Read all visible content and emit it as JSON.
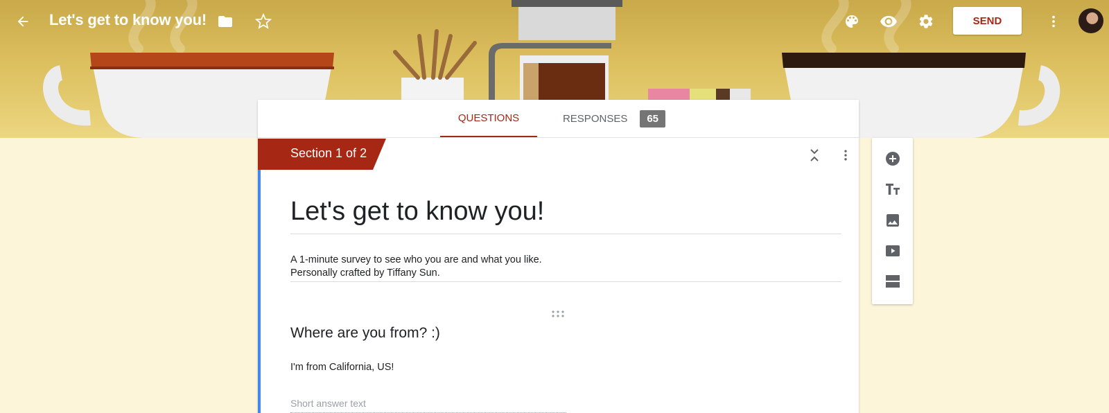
{
  "header": {
    "title": "Let's get to know you!",
    "send_label": "SEND",
    "icons": [
      "back-arrow-icon",
      "folder-icon",
      "star-icon",
      "palette-icon",
      "eye-icon",
      "gear-icon",
      "more-vert-icon"
    ],
    "accent_color": "#a52714"
  },
  "tabs": {
    "questions_label": "QUESTIONS",
    "responses_label": "RESPONSES",
    "responses_count": "65",
    "active": "QUESTIONS"
  },
  "section": {
    "label": "Section 1 of 2",
    "color": "#a52714"
  },
  "form": {
    "title": "Let's get to know you!",
    "description_line1": "A 1-minute survey to see who you are and what you like.",
    "description_line2": "Personally crafted by Tiffany Sun."
  },
  "question": {
    "title": "Where are you from? :)",
    "answer": "I'm from California, US!",
    "placeholder": "Short answer text"
  },
  "toolbar": {
    "tools": [
      "add-question-icon",
      "add-title-icon",
      "add-image-icon",
      "add-video-icon",
      "add-section-icon"
    ]
  }
}
